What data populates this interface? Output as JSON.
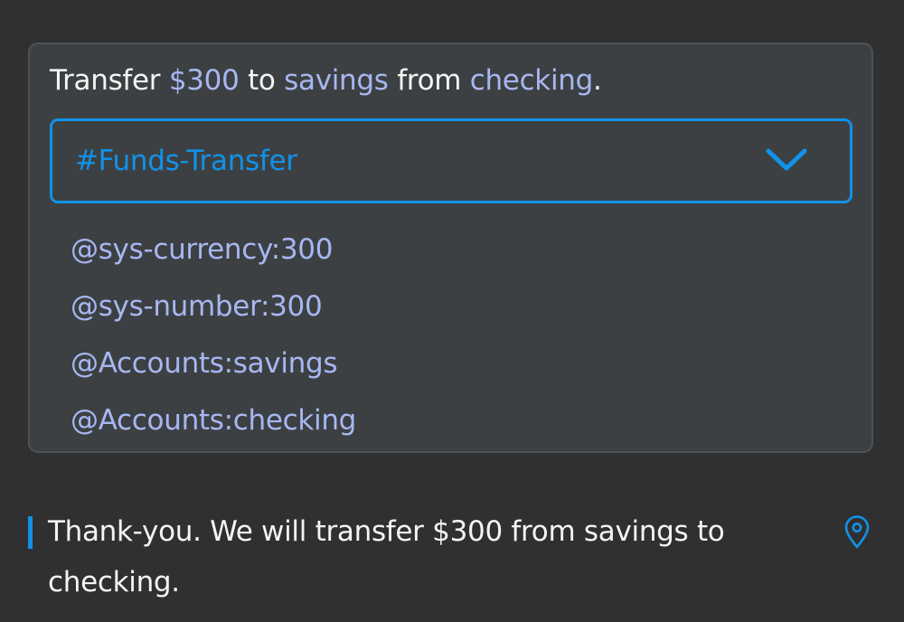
{
  "utterance": {
    "parts": [
      {
        "text": "Transfer ",
        "highlight": false
      },
      {
        "text": "$300",
        "highlight": true
      },
      {
        "text": " to ",
        "highlight": false
      },
      {
        "text": "savings",
        "highlight": true
      },
      {
        "text": " from ",
        "highlight": false
      },
      {
        "text": "checking",
        "highlight": true
      },
      {
        "text": ".",
        "highlight": false
      }
    ]
  },
  "intent": {
    "selected": "#Funds-Transfer",
    "icon": "chevron-down-icon"
  },
  "entities": [
    "@sys-currency:300",
    "@sys-number:300",
    "@Accounts:savings",
    "@Accounts:checking"
  ],
  "response": {
    "text": "Thank-you. We will transfer $300 from savings to checking.",
    "icon": "location-pin-icon"
  },
  "colors": {
    "background": "#303030",
    "card": "#3d4042",
    "accent": "#1192e8",
    "entity": "#a7b7f2",
    "text": "#f4f4f4"
  }
}
